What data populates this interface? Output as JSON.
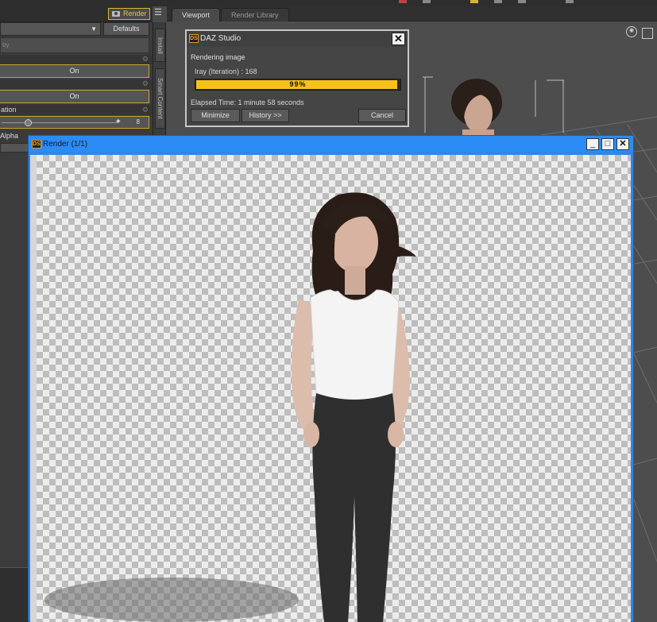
{
  "left_panel": {
    "render_button": "Render",
    "defaults_button": "Defaults",
    "filter_placeholder": "by",
    "toggle_1": "On",
    "toggle_2": "On",
    "slider_label": "ation",
    "slider_value": "8",
    "alpha_label": "Alpha"
  },
  "side_tabs": [
    "Install",
    "Smart Content"
  ],
  "viewport": {
    "tabs": [
      {
        "label": "Viewport",
        "active": true
      },
      {
        "label": "Render Library",
        "active": false
      }
    ]
  },
  "progress_dialog": {
    "title": "DAZ Studio",
    "status": "Rendering image",
    "iteration": "Iray (Iteration) : 168",
    "progress_percent": 99,
    "progress_text": "99%",
    "elapsed": "Elapsed Time:  1 minute 58 seconds",
    "buttons": {
      "minimize": "Minimize",
      "history": "History >>",
      "cancel": "Cancel"
    }
  },
  "render_window": {
    "title": "Render (1/1)",
    "controls": {
      "minimize": "_",
      "maximize": "□",
      "close": "✕"
    }
  },
  "logo_text": "DS",
  "colors": {
    "accent_yellow": "#f5c21a",
    "titlebar_blue": "#2b8cf5",
    "panel_dark": "#3c3c3c"
  }
}
